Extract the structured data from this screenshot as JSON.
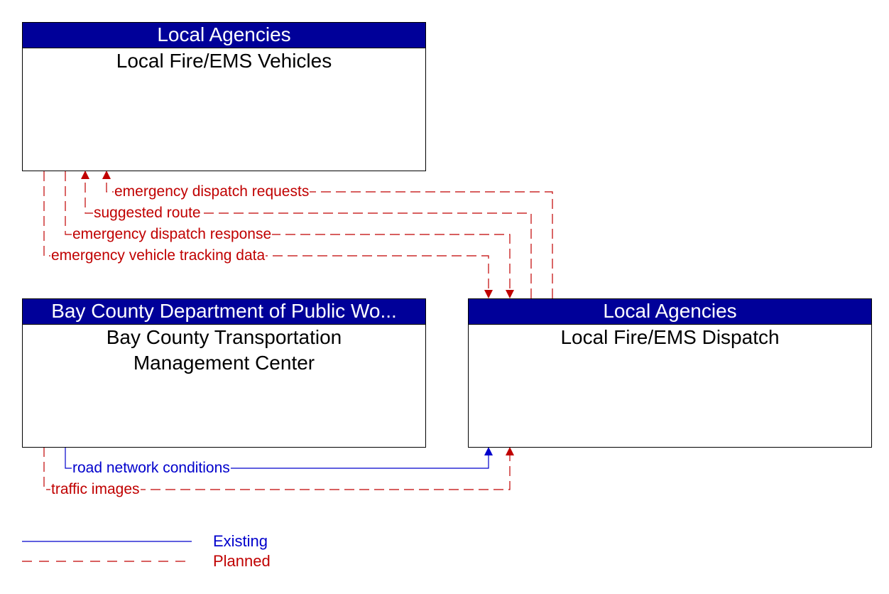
{
  "colors": {
    "header_bg": "#000099",
    "planned": "#c00000",
    "existing": "#0000cc"
  },
  "boxes": {
    "vehicles": {
      "agency": "Local Agencies",
      "name": "Local Fire/EMS Vehicles"
    },
    "tmc": {
      "agency": "Bay County Department of Public Wo...",
      "name_line1": "Bay County Transportation",
      "name_line2": "Management Center"
    },
    "dispatch": {
      "agency": "Local Agencies",
      "name": "Local Fire/EMS Dispatch"
    }
  },
  "flows": [
    {
      "label": "emergency dispatch requests",
      "from": "Local Fire/EMS Dispatch",
      "to": "Local Fire/EMS Vehicles",
      "status": "Planned"
    },
    {
      "label": "suggested route",
      "from": "Local Fire/EMS Dispatch",
      "to": "Local Fire/EMS Vehicles",
      "status": "Planned"
    },
    {
      "label": "emergency dispatch response",
      "from": "Local Fire/EMS Vehicles",
      "to": "Local Fire/EMS Dispatch",
      "status": "Planned"
    },
    {
      "label": "emergency vehicle tracking data",
      "from": "Local Fire/EMS Vehicles",
      "to": "Local Fire/EMS Dispatch",
      "status": "Planned"
    },
    {
      "label": "road network conditions",
      "from": "Bay County Transportation Management Center",
      "to": "Local Fire/EMS Dispatch",
      "status": "Existing"
    },
    {
      "label": "traffic images",
      "from": "Bay County Transportation Management Center",
      "to": "Local Fire/EMS Dispatch",
      "status": "Planned"
    }
  ],
  "legend": {
    "existing": "Existing",
    "planned": "Planned"
  }
}
